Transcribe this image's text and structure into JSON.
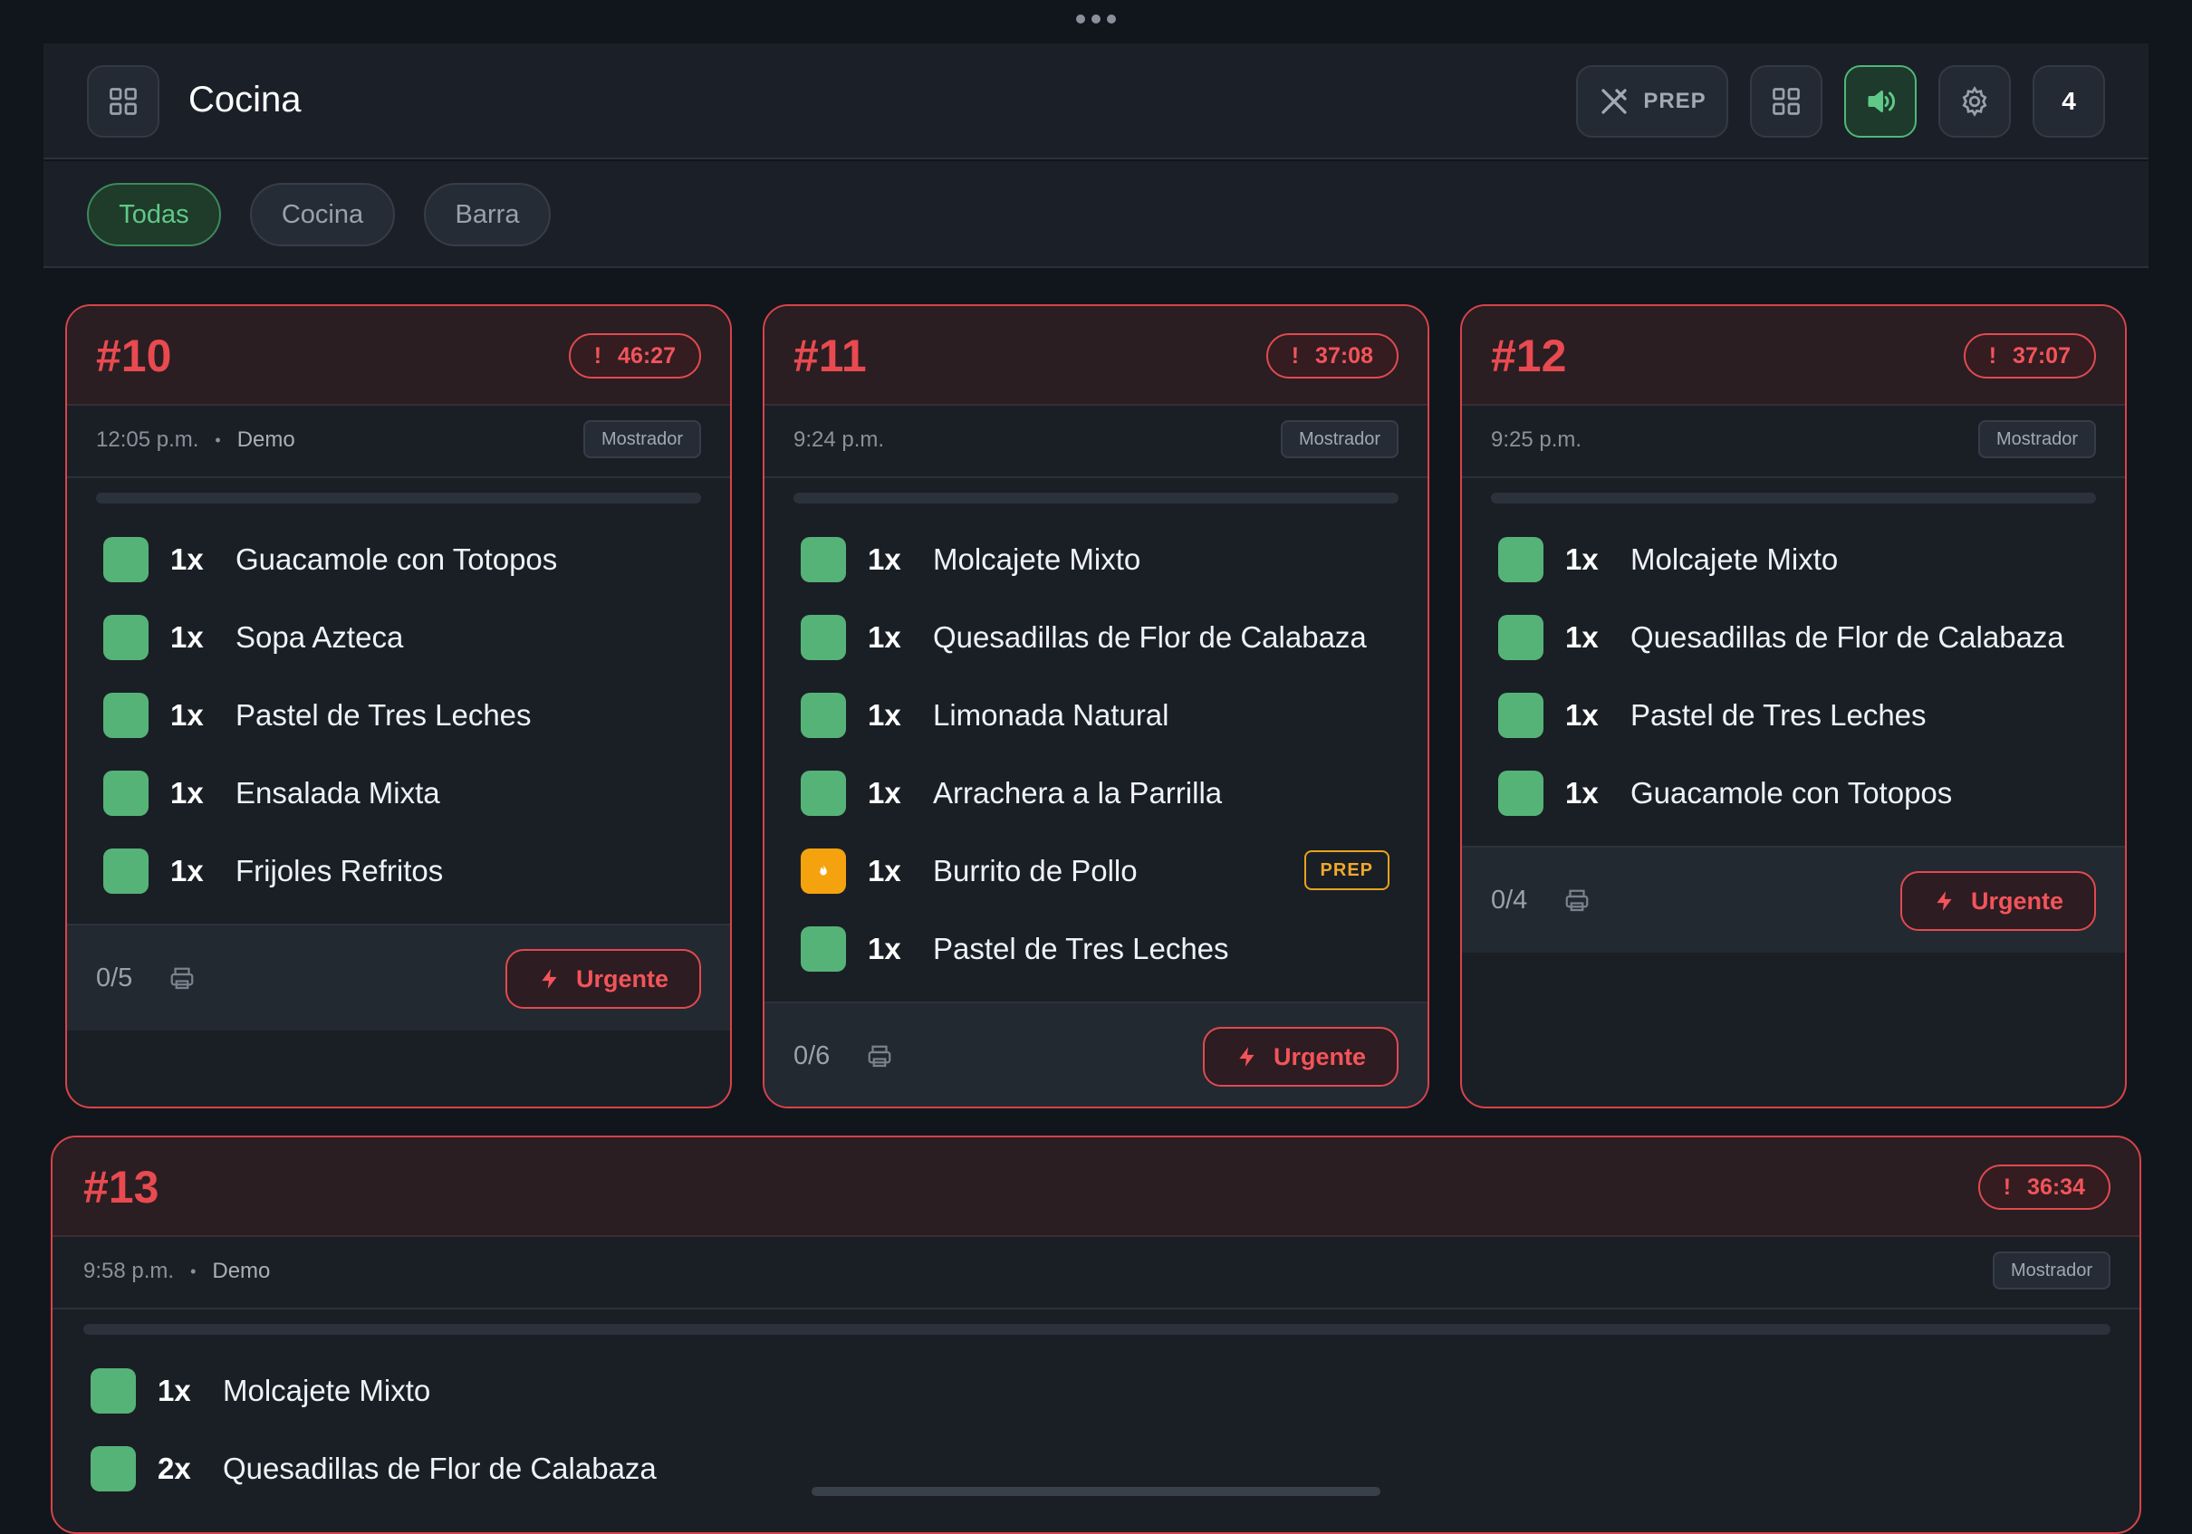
{
  "header": {
    "title": "Cocina",
    "prep_label": "PREP",
    "order_count": "4"
  },
  "filters": [
    {
      "label": "Todas",
      "active": true
    },
    {
      "label": "Cocina",
      "active": false
    },
    {
      "label": "Barra",
      "active": false
    }
  ],
  "orders": [
    {
      "number": "#10",
      "timer": "46:27",
      "time": "12:05 p.m.",
      "customer": "Demo",
      "source": "Mostrador",
      "items": [
        {
          "qty": "1x",
          "name": "Guacamole con Totopos",
          "status": "ready"
        },
        {
          "qty": "1x",
          "name": "Sopa Azteca",
          "status": "ready"
        },
        {
          "qty": "1x",
          "name": "Pastel de Tres Leches",
          "status": "ready"
        },
        {
          "qty": "1x",
          "name": "Ensalada Mixta",
          "status": "ready"
        },
        {
          "qty": "1x",
          "name": "Frijoles Refritos",
          "status": "ready"
        }
      ],
      "progress_text": "0/5",
      "progress_fraction": 0,
      "urgent_label": "Urgente"
    },
    {
      "number": "#11",
      "timer": "37:08",
      "time": "9:24 p.m.",
      "customer": "",
      "source": "Mostrador",
      "items": [
        {
          "qty": "1x",
          "name": "Molcajete Mixto",
          "status": "ready"
        },
        {
          "qty": "1x",
          "name": "Quesadillas de Flor de Calabaza",
          "status": "ready"
        },
        {
          "qty": "1x",
          "name": "Limonada Natural",
          "status": "ready"
        },
        {
          "qty": "1x",
          "name": "Arrachera a la Parrilla",
          "status": "ready"
        },
        {
          "qty": "1x",
          "name": "Burrito de Pollo",
          "status": "prep",
          "tag": "PREP"
        },
        {
          "qty": "1x",
          "name": "Pastel de Tres Leches",
          "status": "ready"
        }
      ],
      "progress_text": "0/6",
      "progress_fraction": 0,
      "urgent_label": "Urgente"
    },
    {
      "number": "#12",
      "timer": "37:07",
      "time": "9:25 p.m.",
      "customer": "",
      "source": "Mostrador",
      "items": [
        {
          "qty": "1x",
          "name": "Molcajete Mixto",
          "status": "ready"
        },
        {
          "qty": "1x",
          "name": "Quesadillas de Flor de Calabaza",
          "status": "ready"
        },
        {
          "qty": "1x",
          "name": "Pastel de Tres Leches",
          "status": "ready"
        },
        {
          "qty": "1x",
          "name": "Guacamole con Totopos",
          "status": "ready"
        }
      ],
      "progress_text": "0/4",
      "progress_fraction": 0,
      "urgent_label": "Urgente"
    },
    {
      "number": "#13",
      "timer": "36:34",
      "time": "9:58 p.m.",
      "customer": "Demo",
      "source": "Mostrador",
      "items": [
        {
          "qty": "1x",
          "name": "Molcajete Mixto",
          "status": "ready"
        },
        {
          "qty": "2x",
          "name": "Quesadillas de Flor de Calabaza",
          "status": "ready"
        }
      ],
      "progress_fraction": 0
    }
  ],
  "colors": {
    "accent_green": "#4fb877",
    "alert_red": "#e84a50",
    "prep_amber": "#f5a20f",
    "background": "#11161c"
  },
  "icons": [
    "grid-icon",
    "utensils-crossed-icon",
    "speaker-icon",
    "gear-icon",
    "printer-icon",
    "lightning-icon",
    "flame-icon",
    "alert-icon"
  ]
}
